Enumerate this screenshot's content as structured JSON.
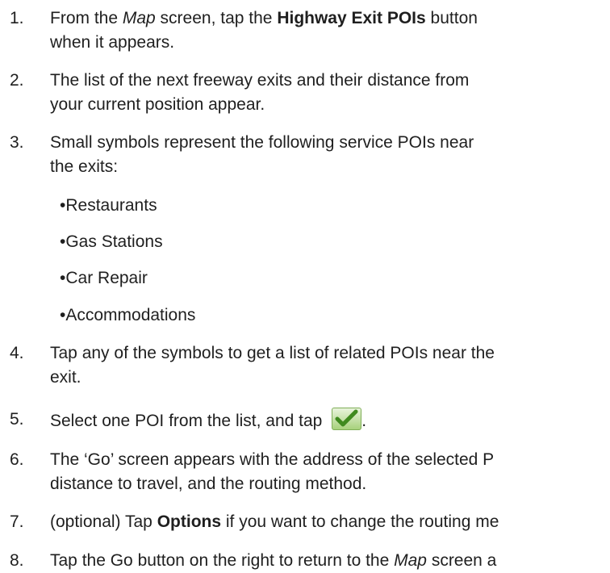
{
  "steps": [
    {
      "num": "1.",
      "line1": {
        "a": "From the ",
        "b": "Map",
        "c": " screen, tap the ",
        "d": "Highway Exit POIs",
        "e": " button"
      },
      "line2": "when it appears."
    },
    {
      "num": "2.",
      "line1": "The list of the next freeway exits and their distance from",
      "line2": "your current position appear."
    },
    {
      "num": "3.",
      "line1": "Small symbols represent the following service POIs near",
      "line2": "the exits:"
    },
    {
      "num": "4.",
      "line1": "Tap any of the symbols to get a list of related POIs near the",
      "line2": "exit."
    },
    {
      "num": "5.",
      "line1a": "Select one POI from the list, and tap ",
      "line1b": "."
    },
    {
      "num": "6.",
      "line1": "The ‘Go’ screen appears with the address of the selected P",
      "line2": "distance to travel, and the routing method."
    },
    {
      "num": "7.",
      "line1": {
        "a": "(optional) Tap ",
        "b": "Options",
        "c": " if you want to change the routing me"
      }
    },
    {
      "num": "8.",
      "line1": {
        "a": "Tap the Go button on the right to return to the ",
        "b": "Map",
        "c": " screen a"
      }
    }
  ],
  "bullets": [
    "•Restaurants",
    "•Gas Stations",
    "•Car Repair",
    "•Accommodations"
  ],
  "checkmark_icon": "green-checkmark-icon",
  "colors": {
    "text": "#1f1f1f",
    "check_green": "#5a9e2f"
  }
}
